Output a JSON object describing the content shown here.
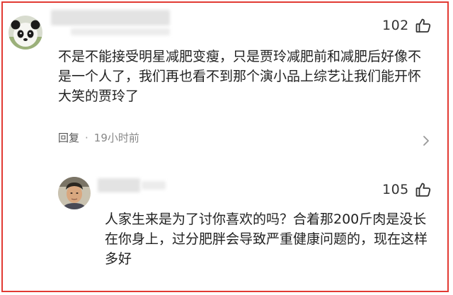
{
  "comment": {
    "like_count": "102",
    "text": "不是不能接受明星减肥变瘦，只是贾玲减肥前和减肥后好像不是一个人了，我们再也看不到那个演小品上综艺让我们能开怀大笑的贾玲了",
    "reply_label": "回复",
    "separator": "·",
    "time": "19小时前",
    "avatar_icon": "panda-avatar",
    "like_icon": "thumbs-up-icon",
    "more_icon": "chevron-right-icon"
  },
  "reply": {
    "like_count": "105",
    "text": "人家生来是为了讨你喜欢的吗？合着那200斤肉是没长在你身上，过分肥胖会导致严重健康问题的，现在这样多好",
    "avatar_icon": "man-avatar",
    "like_icon": "thumbs-up-icon"
  },
  "colors": {
    "frame_border": "#e23a33"
  }
}
